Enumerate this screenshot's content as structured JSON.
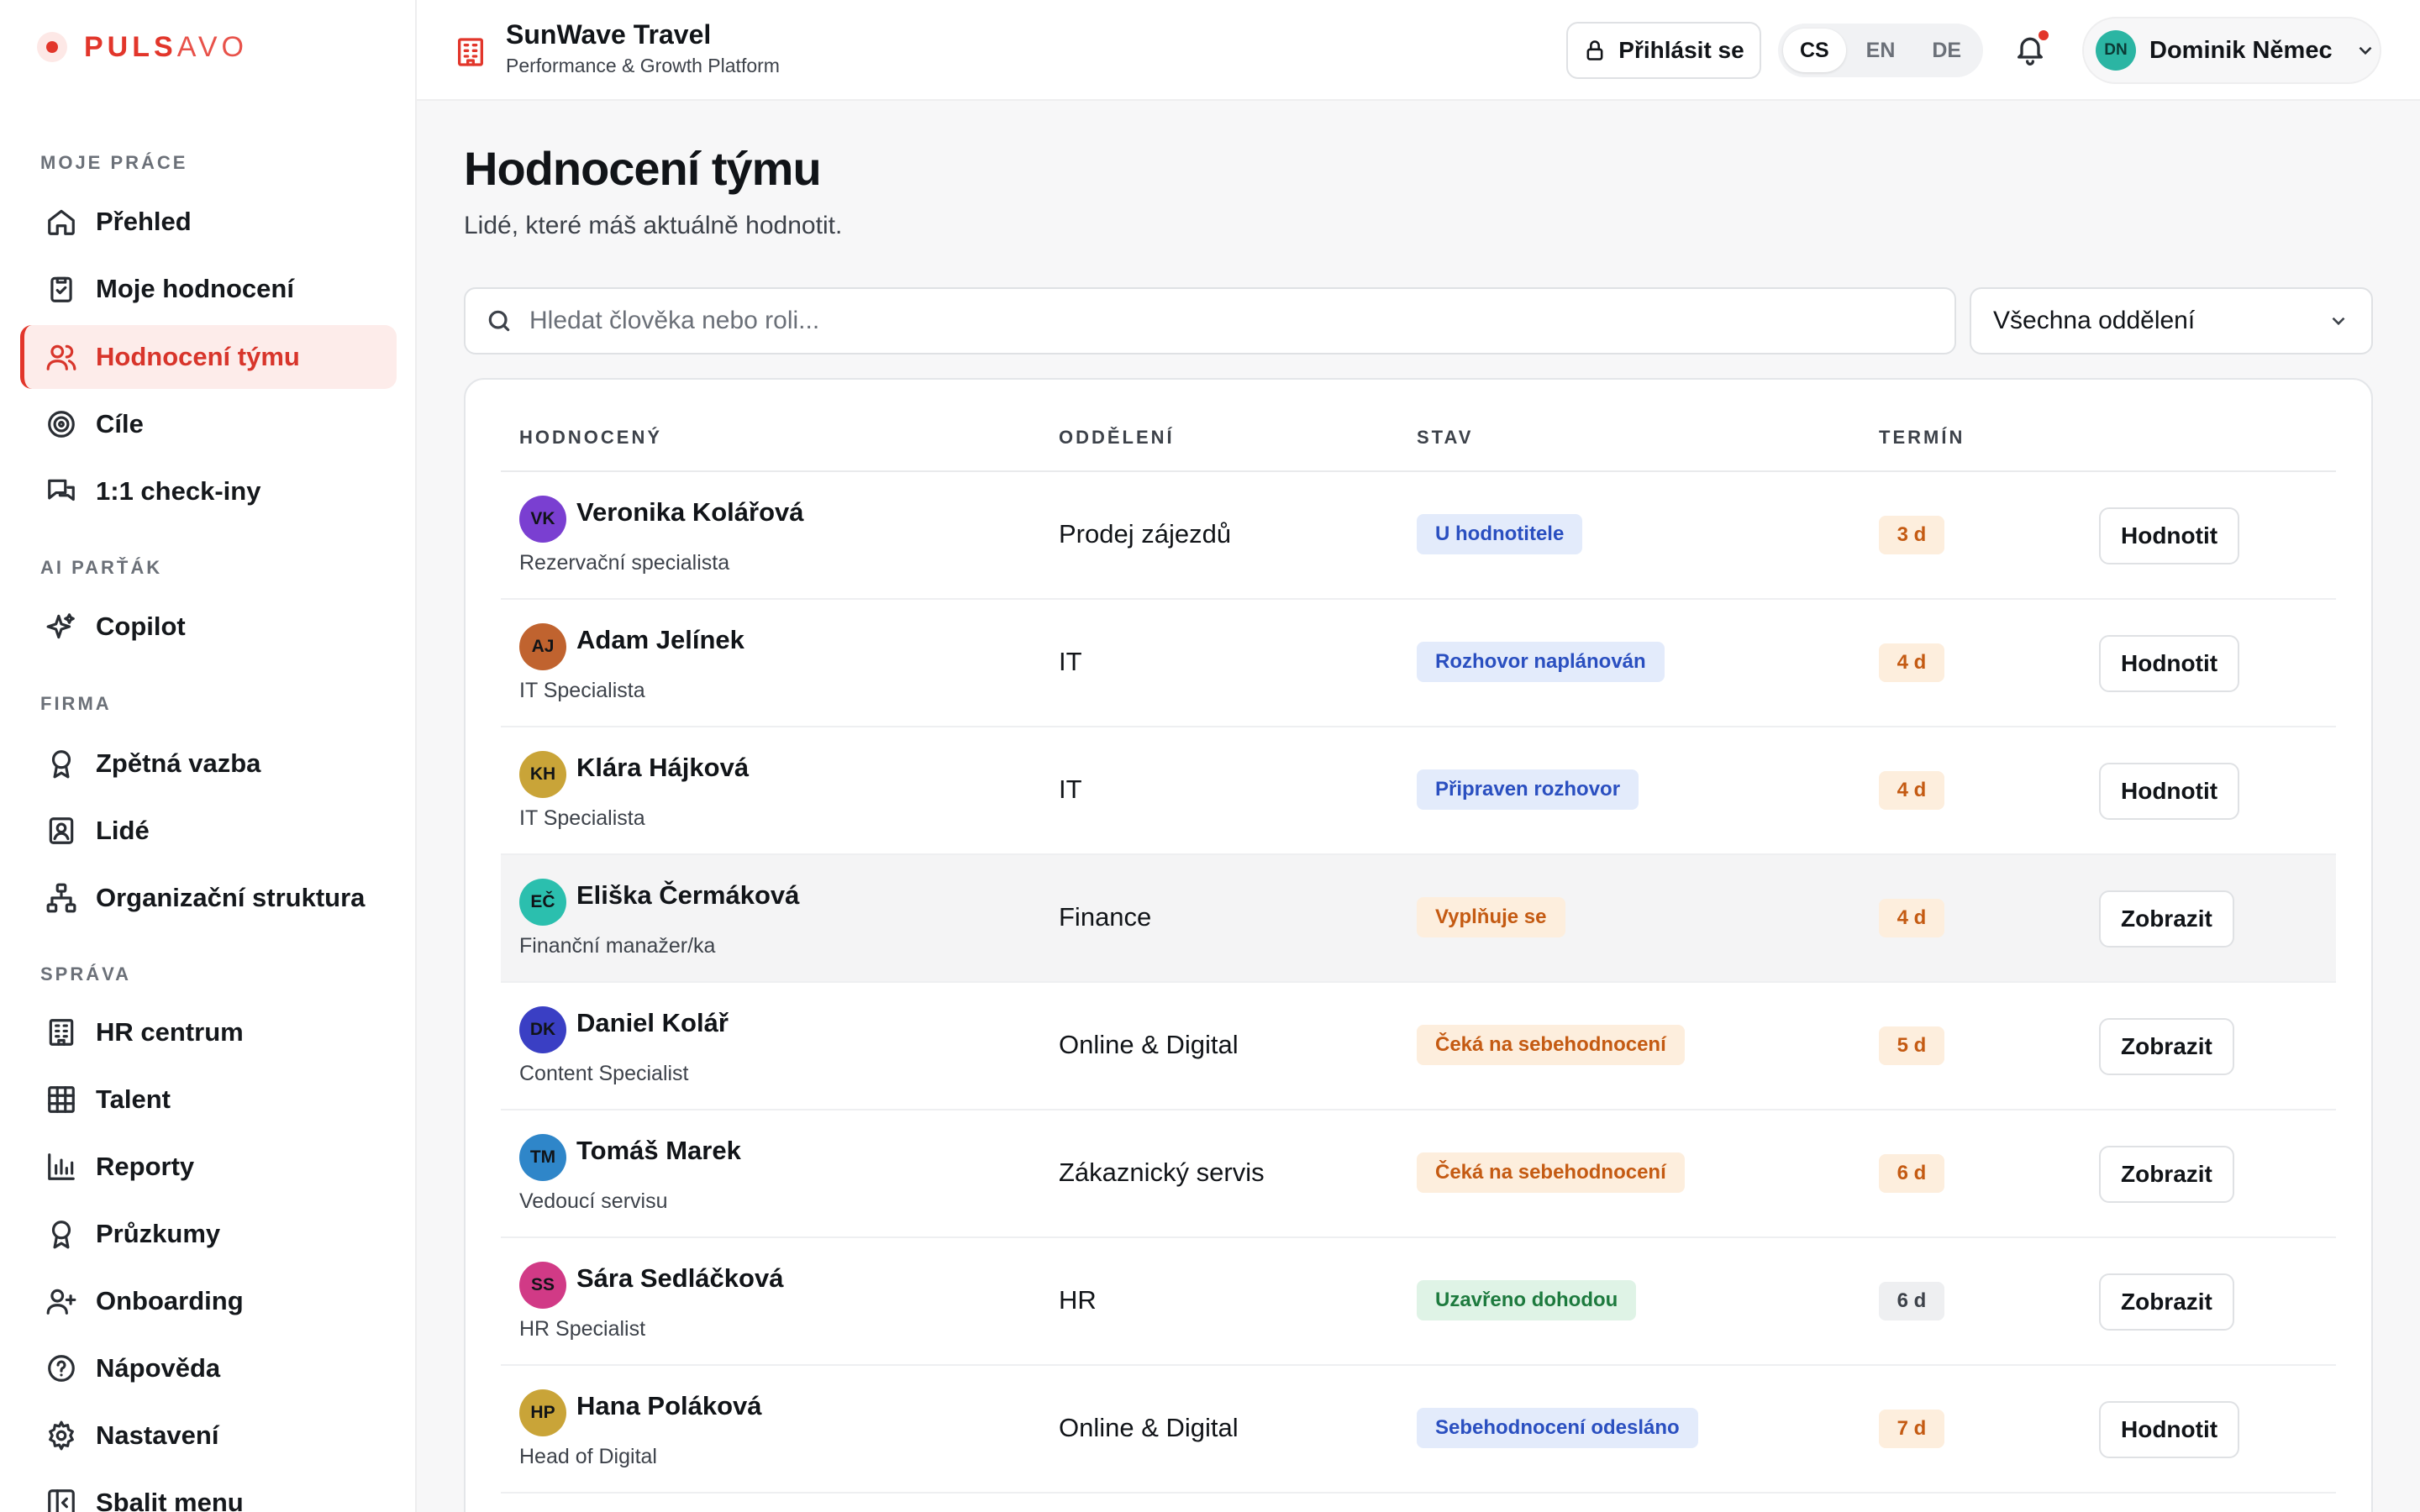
{
  "logo": {
    "strong": "PULS",
    "light": "AVO"
  },
  "sidebar": {
    "sections": [
      "MOJE PRÁCE",
      "AI PARŤÁK",
      "FIRMA",
      "SPRÁVA"
    ],
    "items": [
      {
        "label": "Přehled",
        "icon": "home-icon"
      },
      {
        "label": "Moje hodnocení",
        "icon": "clipboard-check-icon"
      },
      {
        "label": "Hodnocení týmu",
        "icon": "users-icon"
      },
      {
        "label": "Cíle",
        "icon": "target-icon"
      },
      {
        "label": "1:1 check-iny",
        "icon": "chat-bubbles-icon"
      },
      {
        "label": "Copilot",
        "icon": "sparkles-icon"
      },
      {
        "label": "Zpětná vazba",
        "icon": "award-icon"
      },
      {
        "label": "Lidé",
        "icon": "contact-card-icon"
      },
      {
        "label": "Organizační struktura",
        "icon": "org-chart-icon"
      },
      {
        "label": "HR centrum",
        "icon": "building-icon"
      },
      {
        "label": "Talent",
        "icon": "grid-icon"
      },
      {
        "label": "Reporty",
        "icon": "bar-chart-icon"
      },
      {
        "label": "Průzkumy",
        "icon": "award-icon"
      },
      {
        "label": "Onboarding",
        "icon": "user-plus-icon"
      },
      {
        "label": "Nápověda",
        "icon": "help-circle-icon"
      },
      {
        "label": "Nastavení",
        "icon": "gear-icon"
      },
      {
        "label": "Sbalit menu",
        "icon": "collapse-icon"
      }
    ],
    "active_index": 2
  },
  "header": {
    "company": "SunWave Travel",
    "platform": "Performance & Growth Platform",
    "login_label": "Přihlásit se",
    "languages": [
      "CS",
      "EN",
      "DE"
    ],
    "selected_language": "CS",
    "user_initials": "DN",
    "user_name": "Dominik Němec"
  },
  "main": {
    "title": "Hodnocení týmu",
    "subtitle": "Lidé, které máš aktuálně hodnotit.",
    "search_placeholder": "Hledat člověka nebo roli...",
    "department_filter": "Všechna oddělení",
    "columns": [
      "HODNOCENÝ",
      "ODDĚLENÍ",
      "STAV",
      "TERMÍN"
    ],
    "rows": [
      {
        "initials": "VK",
        "name": "Veronika Kolářová",
        "role": "Rezervační specialista",
        "dept": "Prodej zájezdů",
        "status": "U hodnotitele",
        "due": "3 d",
        "action": "Hodnotit",
        "avatar_color": "#7a3fd1",
        "status_tone": "blue",
        "due_tone": "orange"
      },
      {
        "initials": "AJ",
        "name": "Adam Jelínek",
        "role": "IT Specialista",
        "dept": "IT",
        "status": "Rozhovor naplánován",
        "due": "4 d",
        "action": "Hodnotit",
        "avatar_color": "#c0632f",
        "status_tone": "blue",
        "due_tone": "orange"
      },
      {
        "initials": "KH",
        "name": "Klára Hájková",
        "role": "IT Specialista",
        "dept": "IT",
        "status": "Připraven rozhovor",
        "due": "4 d",
        "action": "Hodnotit",
        "avatar_color": "#c9a438",
        "status_tone": "blue",
        "due_tone": "orange"
      },
      {
        "initials": "EČ",
        "name": "Eliška Čermáková",
        "role": "Finanční manažer/ka",
        "dept": "Finance",
        "status": "Vyplňuje se",
        "due": "4 d",
        "action": "Zobrazit",
        "avatar_color": "#2bbfae",
        "status_tone": "orange",
        "due_tone": "orange"
      },
      {
        "initials": "DK",
        "name": "Daniel Kolář",
        "role": "Content Specialist",
        "dept": "Online & Digital",
        "status": "Čeká na sebehodnocení",
        "due": "5 d",
        "action": "Zobrazit",
        "avatar_color": "#3a3fc4",
        "status_tone": "orange",
        "due_tone": "orange"
      },
      {
        "initials": "TM",
        "name": "Tomáš Marek",
        "role": "Vedoucí servisu",
        "dept": "Zákaznický servis",
        "status": "Čeká na sebehodnocení",
        "due": "6 d",
        "action": "Zobrazit",
        "avatar_color": "#2f86c9",
        "status_tone": "orange",
        "due_tone": "orange"
      },
      {
        "initials": "SS",
        "name": "Sára Sedláčková",
        "role": "HR Specialist",
        "dept": "HR",
        "status": "Uzavřeno dohodou",
        "due": "6 d",
        "action": "Zobrazit",
        "avatar_color": "#d13a86",
        "status_tone": "green",
        "due_tone": "gray"
      },
      {
        "initials": "HP",
        "name": "Hana Poláková",
        "role": "Head of Digital",
        "dept": "Online & Digital",
        "status": "Sebehodnocení odesláno",
        "due": "7 d",
        "action": "Hodnotit",
        "avatar_color": "#c9a438",
        "status_tone": "blue",
        "due_tone": "orange"
      }
    ],
    "highlighted_row": 3
  },
  "tones": {
    "blue": {
      "bg": "#e3ebfb",
      "fg": "#2a4fc0"
    },
    "orange": {
      "bg": "#fdeedd",
      "fg": "#c45a12"
    },
    "green": {
      "bg": "#dff3e6",
      "fg": "#1d7a3e"
    },
    "gray": {
      "bg": "#eeeff1",
      "fg": "#3d424a"
    }
  }
}
